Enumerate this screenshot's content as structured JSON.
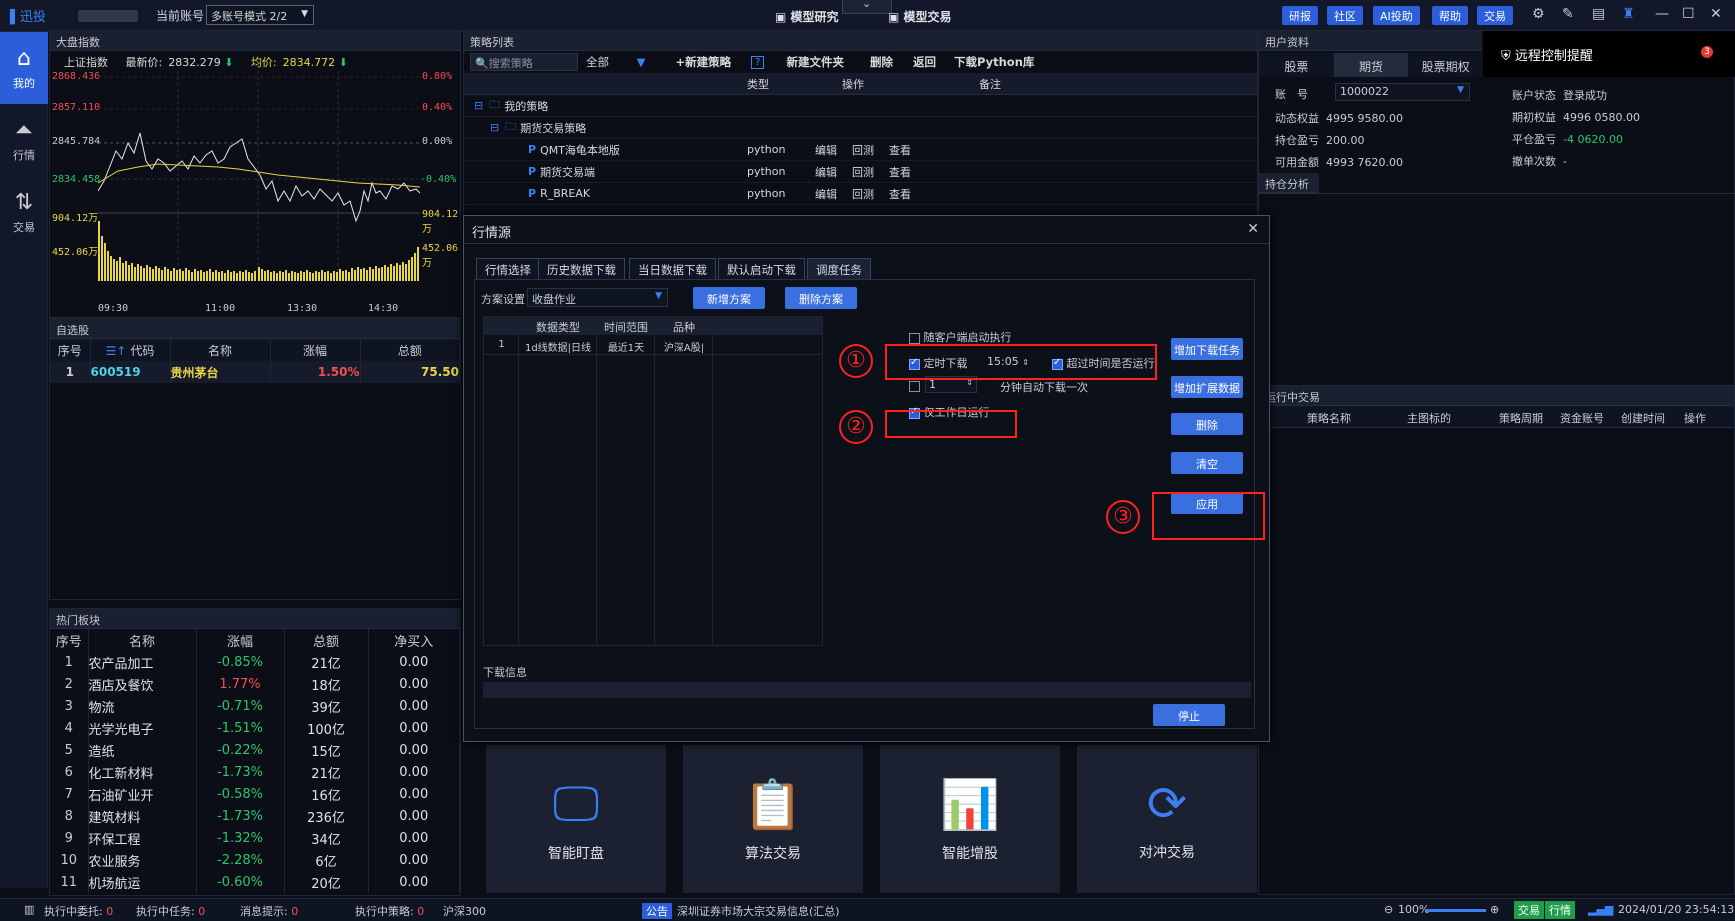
{
  "topbar": {
    "logo": "迅投",
    "account_label": "当前账号",
    "account_mode": "多账号模式 2/2",
    "mid_tabs": [
      "模型研究",
      "模型交易"
    ],
    "buttons": [
      "研报",
      "社区",
      "AI投助",
      "帮助",
      "交易"
    ]
  },
  "sidebar": {
    "items": [
      {
        "label": "我的",
        "icon": "home-icon"
      },
      {
        "label": "行情",
        "icon": "chart-icon"
      },
      {
        "label": "交易",
        "icon": "exchange-icon"
      }
    ]
  },
  "index_panel": {
    "header": "大盘指数",
    "name": "上证指数",
    "latest_label": "最新价:",
    "latest": "2832.279",
    "avg_label": "均价:",
    "avg": "2834.772",
    "left_ticks": [
      "2868.436",
      "2857.110",
      "2845.784",
      "2834.458",
      "904.12万",
      "452.06万"
    ],
    "right_ticks": [
      "0.80%",
      "0.40%",
      "0.00%",
      "-0.40%",
      "904.12万",
      "452.06万"
    ],
    "time_ticks": [
      "09:30",
      "11:00",
      "13:30",
      "14:30"
    ]
  },
  "watchlist": {
    "header": "自选股",
    "columns": [
      "序号",
      "代码",
      "名称",
      "涨幅",
      "总额"
    ],
    "rows": [
      [
        "1",
        "600519",
        "贵州茅台",
        "1.50%",
        "75.50"
      ]
    ]
  },
  "hot_sectors": {
    "header": "热门板块",
    "columns": [
      "序号",
      "名称",
      "涨幅",
      "总额",
      "净买入"
    ],
    "rows": [
      [
        "1",
        "农产品加工",
        "-0.85%",
        "21亿",
        "0.00"
      ],
      [
        "2",
        "酒店及餐饮",
        "1.77%",
        "18亿",
        "0.00"
      ],
      [
        "3",
        "物流",
        "-0.71%",
        "39亿",
        "0.00"
      ],
      [
        "4",
        "光学光电子",
        "-1.51%",
        "100亿",
        "0.00"
      ],
      [
        "5",
        "造纸",
        "-0.22%",
        "15亿",
        "0.00"
      ],
      [
        "6",
        "化工新材料",
        "-1.73%",
        "21亿",
        "0.00"
      ],
      [
        "7",
        "石油矿业开",
        "-0.58%",
        "16亿",
        "0.00"
      ],
      [
        "8",
        "建筑材料",
        "-1.73%",
        "236亿",
        "0.00"
      ],
      [
        "9",
        "环保工程",
        "-1.32%",
        "34亿",
        "0.00"
      ],
      [
        "10",
        "农业服务",
        "-2.28%",
        "6亿",
        "0.00"
      ],
      [
        "11",
        "机场航运",
        "-0.60%",
        "20亿",
        "0.00"
      ]
    ]
  },
  "strategy_list": {
    "header": "策略列表",
    "search_placeholder": "搜索策略",
    "filter": "全部",
    "actions": [
      "+新建策略",
      "新建文件夹",
      "删除",
      "返回",
      "下载Python库"
    ],
    "columns": [
      "类型",
      "操作",
      "备注"
    ],
    "tree": [
      {
        "label": "我的策略",
        "level": 0
      },
      {
        "label": "期货交易策略",
        "level": 1
      },
      {
        "label": "QMT海龟本地版",
        "level": 2,
        "type": "python",
        "ops": [
          "编辑",
          "回测",
          "查看"
        ]
      },
      {
        "label": "期货交易端",
        "level": 2,
        "type": "python",
        "ops": [
          "编辑",
          "回测",
          "查看"
        ]
      },
      {
        "label": "R_BREAK",
        "level": 2,
        "type": "python",
        "ops": [
          "编辑",
          "回测",
          "查看"
        ]
      }
    ]
  },
  "user_panel": {
    "header": "用户资料",
    "tabs": [
      "股票",
      "期货",
      "股票期权"
    ],
    "remote": "远程控制提醒",
    "badge": "3",
    "account_label": "账　号",
    "account": "1000022",
    "fields_left": [
      {
        "k": "动态权益",
        "v": "4995 9580.00"
      },
      {
        "k": "持仓盈亏",
        "v": "200.00"
      },
      {
        "k": "可用金额",
        "v": "4993 7620.00"
      }
    ],
    "fields_right": [
      {
        "k": "账户状态",
        "v": "登录成功"
      },
      {
        "k": "期初权益",
        "v": "4996 0580.00"
      },
      {
        "k": "平仓盈亏",
        "v": "-4 0620.00"
      },
      {
        "k": "撤单次数",
        "v": "-"
      }
    ],
    "position_header": "持仓分析"
  },
  "running": {
    "header": "运行中交易",
    "columns": [
      "策略名称",
      "主图标的",
      "策略周期",
      "资金账号",
      "创建时间",
      "操作"
    ]
  },
  "dialog": {
    "title": "行情源",
    "tabs": [
      "行情选择",
      "历史数据下载",
      "当日数据下载",
      "默认启动下载",
      "调度任务"
    ],
    "scheme_label": "方案设置",
    "scheme_value": "收盘作业",
    "add_scheme": "新增方案",
    "delete_scheme": "删除方案",
    "table_columns": [
      "数据类型",
      "时间范围",
      "品种"
    ],
    "table_rows": [
      [
        "1",
        "1d线数据|日线",
        "最近1天",
        "沪深A股|"
      ]
    ],
    "auto_run": "随客户端启动执行",
    "timed_download": "定时下载",
    "time_value": "15:05",
    "overtime_run": "超过时间是否运行",
    "interval_value": "1",
    "interval_label": "分钟自动下载一次",
    "workday_only": "仅工作日运行",
    "btn_add_task": "增加下载任务",
    "btn_add_ext": "增加扩展数据",
    "btn_delete": "删除",
    "btn_clear": "清空",
    "btn_apply": "应用",
    "download_info": "下载信息",
    "btn_stop": "停止",
    "markers": [
      "①",
      "②",
      "③"
    ]
  },
  "tiles": [
    "智能盯盘",
    "算法交易",
    "智能增股",
    "对冲交易"
  ],
  "statusbar": {
    "items": [
      {
        "k": "执行中委托:",
        "v": "0"
      },
      {
        "k": "执行中任务:",
        "v": "0"
      },
      {
        "k": "消息提示:",
        "v": "0"
      },
      {
        "k": "执行中策略:",
        "v": "0"
      }
    ],
    "index_name": "沪深300",
    "notice_tag": "公告",
    "notice": "深圳证券市场大宗交易信息(汇总)",
    "zoom": "100%",
    "trade": "交易",
    "quote": "行情",
    "datetime": "2024/01/20 23:54:13"
  }
}
